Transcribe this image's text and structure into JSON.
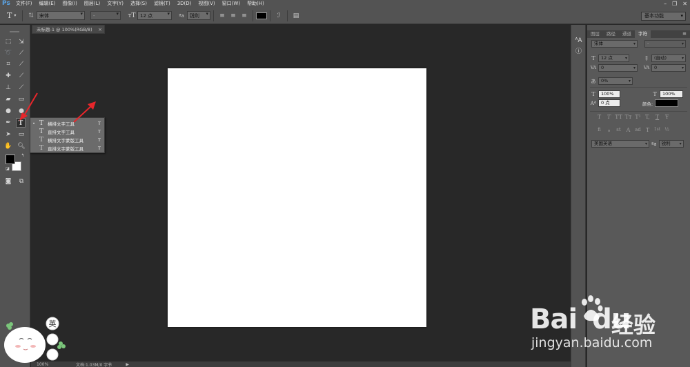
{
  "menubar": {
    "logo": "Ps",
    "items": [
      "文件(F)",
      "编辑(E)",
      "图像(I)",
      "图层(L)",
      "文字(Y)",
      "选择(S)",
      "滤镜(T)",
      "3D(D)",
      "视图(V)",
      "窗口(W)",
      "帮助(H)"
    ],
    "window_controls": [
      "–",
      "❐",
      "✕"
    ]
  },
  "options": {
    "font_family": "宋体",
    "font_style": "-",
    "font_size": "12 点",
    "aa_label": "ªa",
    "antialias": "锐利",
    "workspace": "基本功能"
  },
  "document": {
    "tab_title": "未标题-1 @ 100%(RGB/8)",
    "close": "×"
  },
  "statusbar": {
    "zoom": "100%",
    "doc_info": "文档:1.03M/0 字节",
    "arrow": "▶"
  },
  "flyout": {
    "items": [
      {
        "label": "横排文字工具",
        "key": "T",
        "selected": "•"
      },
      {
        "label": "直排文字工具",
        "key": "T",
        "selected": ""
      },
      {
        "label": "横排文字蒙版工具",
        "key": "T",
        "selected": ""
      },
      {
        "label": "直排文字蒙版工具",
        "key": "T",
        "selected": ""
      }
    ]
  },
  "panel": {
    "tabs": [
      "图层",
      "路径",
      "通道",
      "字符"
    ],
    "active_tab": "字符",
    "menu": "≡",
    "font_family": "宋体",
    "font_style": "-",
    "font_size": "12 点",
    "leading": "(自动)",
    "kerning": "0",
    "tracking": "0",
    "scale_percent": "0%",
    "vertical_scale": "100%",
    "horizontal_scale": "100%",
    "baseline_shift": "0 点",
    "color_label": "颜色:",
    "language": "美国英语",
    "antialias": "锐利",
    "style_buttons": [
      "T",
      "T",
      "TT",
      "Tт",
      "T¹",
      "T,",
      "T",
      "Ŧ"
    ],
    "opentype_buttons": [
      "fi",
      "ℴ",
      "st",
      "A",
      "ad",
      "T",
      "1st",
      "½"
    ]
  },
  "watermark": {
    "logo": "Bai",
    "logo_suffix": "du",
    "jingyan": "经验",
    "url": "jingyan.baidu.com"
  },
  "sticker": {
    "label": "英"
  },
  "colors": {
    "ui_dark": "#535353",
    "canvas_bg": "#282828",
    "arrow_red": "#e8262b",
    "ps_blue": "#5aa4e6"
  }
}
